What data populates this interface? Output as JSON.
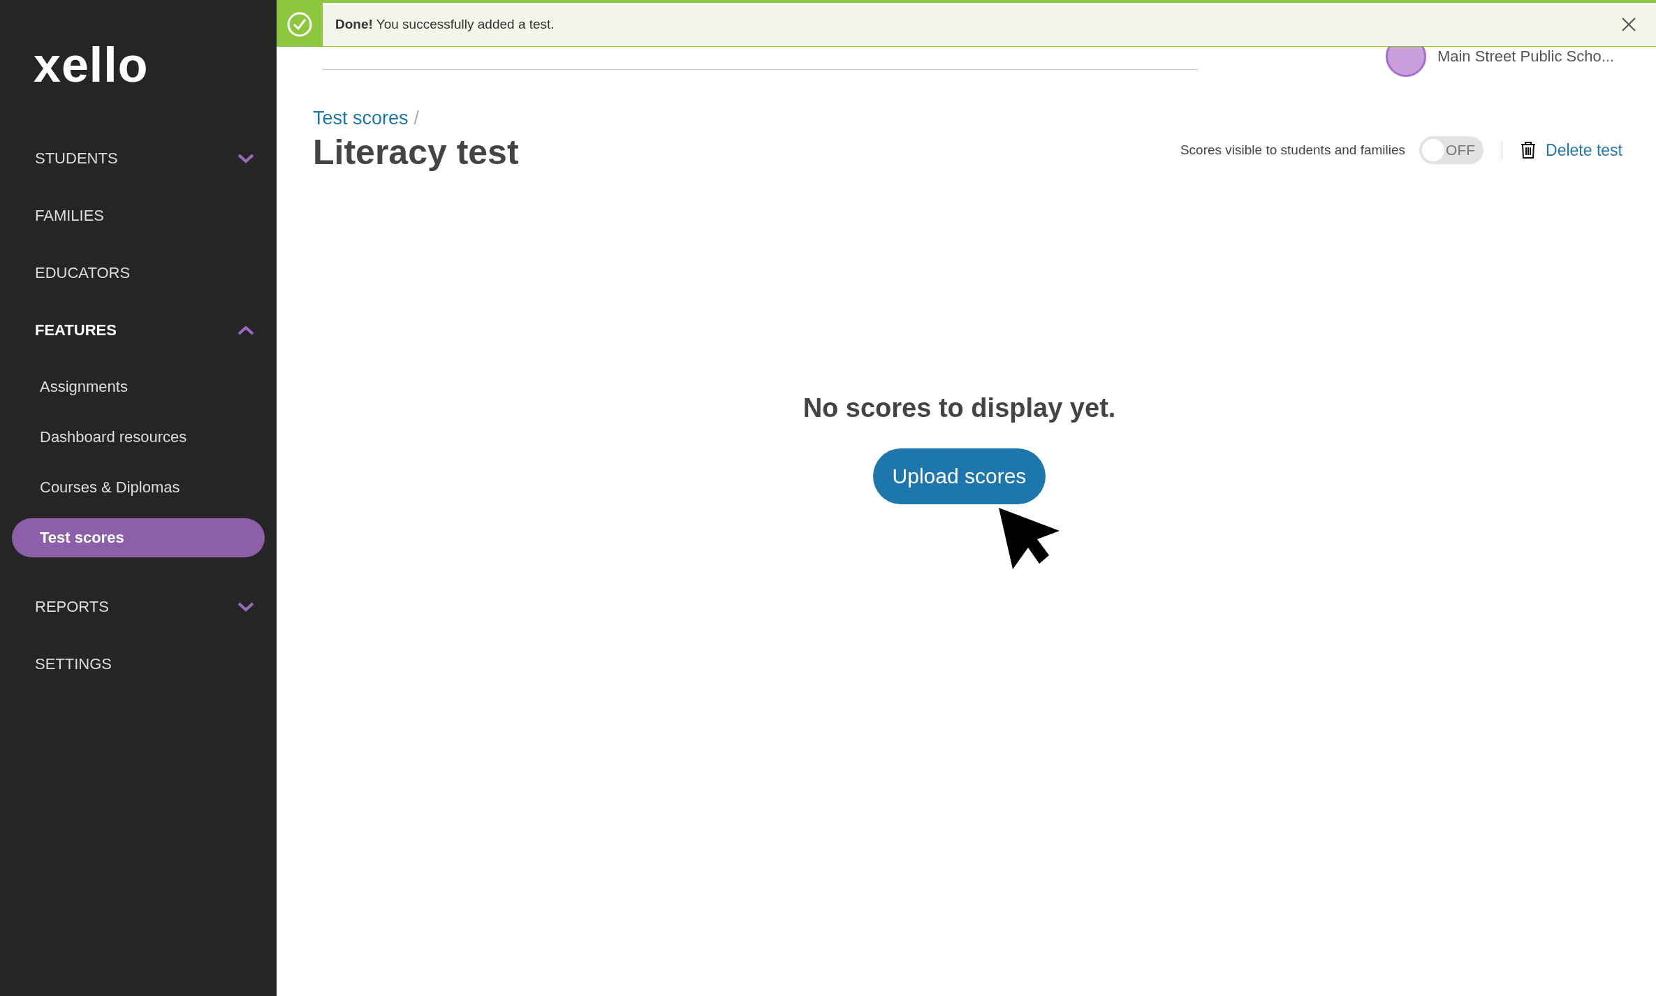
{
  "banner": {
    "message": "**Done!** You successfully added a test."
  },
  "sidebar": {
    "logo": "xello",
    "items": [
      {
        "label": "STUDENTS",
        "expanded": false,
        "active": false
      },
      {
        "label": "FAMILIES",
        "active": false
      },
      {
        "label": "EDUCATORS",
        "active": false
      },
      {
        "label": "FEATURES",
        "expanded": true,
        "active": true,
        "children": [
          {
            "label": "Assignments",
            "selected": false
          },
          {
            "label": "Dashboard resources",
            "selected": false
          },
          {
            "label": "Courses & Diplomas",
            "selected": false
          },
          {
            "label": "Test scores",
            "selected": true
          }
        ]
      },
      {
        "label": "REPORTS",
        "expanded": false,
        "active": false
      },
      {
        "label": "SETTINGS",
        "active": false
      }
    ]
  },
  "header": {
    "school": "Main Street Public Scho..."
  },
  "breadcrumb": {
    "link": "Test scores",
    "separator": "/"
  },
  "title": "Literacy test",
  "visibility": {
    "label": "Scores visible to students and families",
    "on": false,
    "state": "OFF"
  },
  "delete_action": "Delete test",
  "empty_state": {
    "message": "No scores to display yet.",
    "button": "Upload scores"
  }
}
